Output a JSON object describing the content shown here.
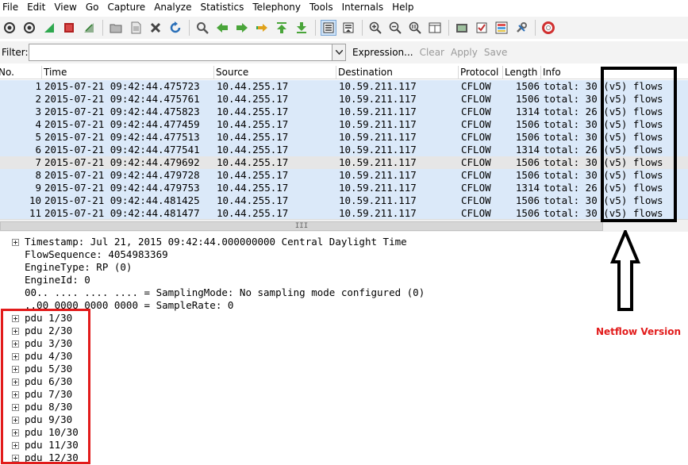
{
  "menu": [
    "File",
    "Edit",
    "View",
    "Go",
    "Capture",
    "Analyze",
    "Statistics",
    "Telephony",
    "Tools",
    "Internals",
    "Help"
  ],
  "toolbar": {
    "icons": [
      "interface-list-icon",
      "capture-options-icon",
      "start-capture-icon",
      "stop-capture-icon",
      "restart-capture-icon",
      "open-file-icon",
      "save-file-icon",
      "close-file-icon",
      "reload-icon",
      "find-icon",
      "go-back-icon",
      "go-forward-icon",
      "go-to-packet-icon",
      "go-first-icon",
      "go-last-icon",
      "colorize-icon",
      "auto-scroll-icon",
      "zoom-in-icon",
      "zoom-out-icon",
      "normal-size-icon",
      "resize-columns-icon",
      "capture-filters-icon",
      "display-filters-icon",
      "coloring-rules-icon",
      "preferences-icon",
      "help-icon"
    ]
  },
  "filter": {
    "label": "Filter:",
    "value": "",
    "expression_label": "Expression...",
    "clear_label": "Clear",
    "apply_label": "Apply",
    "save_label": "Save"
  },
  "packet_list": {
    "columns": [
      "No.",
      "Time",
      "Source",
      "Destination",
      "Protocol",
      "Length",
      "Info"
    ],
    "rows": [
      {
        "no": "1",
        "time": "2015-07-21 09:42:44.475723",
        "src": "10.44.255.17",
        "dst": "10.59.211.117",
        "proto": "CFLOW",
        "len": "1506",
        "info": "total: 30 (v5) flows"
      },
      {
        "no": "2",
        "time": "2015-07-21 09:42:44.475761",
        "src": "10.44.255.17",
        "dst": "10.59.211.117",
        "proto": "CFLOW",
        "len": "1506",
        "info": "total: 30 (v5) flows"
      },
      {
        "no": "3",
        "time": "2015-07-21 09:42:44.475823",
        "src": "10.44.255.17",
        "dst": "10.59.211.117",
        "proto": "CFLOW",
        "len": "1314",
        "info": "total: 26 (v5) flows"
      },
      {
        "no": "4",
        "time": "2015-07-21 09:42:44.477459",
        "src": "10.44.255.17",
        "dst": "10.59.211.117",
        "proto": "CFLOW",
        "len": "1506",
        "info": "total: 30 (v5) flows"
      },
      {
        "no": "5",
        "time": "2015-07-21 09:42:44.477513",
        "src": "10.44.255.17",
        "dst": "10.59.211.117",
        "proto": "CFLOW",
        "len": "1506",
        "info": "total: 30 (v5) flows"
      },
      {
        "no": "6",
        "time": "2015-07-21 09:42:44.477541",
        "src": "10.44.255.17",
        "dst": "10.59.211.117",
        "proto": "CFLOW",
        "len": "1314",
        "info": "total: 26 (v5) flows"
      },
      {
        "no": "7",
        "time": "2015-07-21 09:42:44.479692",
        "src": "10.44.255.17",
        "dst": "10.59.211.117",
        "proto": "CFLOW",
        "len": "1506",
        "info": "total: 30 (v5) flows"
      },
      {
        "no": "8",
        "time": "2015-07-21 09:42:44.479728",
        "src": "10.44.255.17",
        "dst": "10.59.211.117",
        "proto": "CFLOW",
        "len": "1506",
        "info": "total: 30 (v5) flows"
      },
      {
        "no": "9",
        "time": "2015-07-21 09:42:44.479753",
        "src": "10.44.255.17",
        "dst": "10.59.211.117",
        "proto": "CFLOW",
        "len": "1314",
        "info": "total: 26 (v5) flows"
      },
      {
        "no": "10",
        "time": "2015-07-21 09:42:44.481425",
        "src": "10.44.255.17",
        "dst": "10.59.211.117",
        "proto": "CFLOW",
        "len": "1506",
        "info": "total: 30 (v5) flows"
      },
      {
        "no": "11",
        "time": "2015-07-21 09:42:44.481477",
        "src": "10.44.255.17",
        "dst": "10.59.211.117",
        "proto": "CFLOW",
        "len": "1506",
        "info": "total: 30 (v5) flows"
      }
    ],
    "scroll_grip": "III"
  },
  "detail": {
    "lines": [
      {
        "text": "Timestamp: Jul 21, 2015 09:42:44.000000000 Central Daylight Time",
        "expandable": true
      },
      {
        "text": "FlowSequence: 4054983369",
        "expandable": false
      },
      {
        "text": "EngineType: RP (0)",
        "expandable": false
      },
      {
        "text": "EngineId: 0",
        "expandable": false
      },
      {
        "text": "00.. .... .... .... = SamplingMode: No sampling mode configured (0)",
        "expandable": false
      },
      {
        "text": "..00 0000 0000 0000 = SampleRate: 0",
        "expandable": false
      },
      {
        "text": "pdu 1/30",
        "expandable": true
      },
      {
        "text": "pdu 2/30",
        "expandable": true
      },
      {
        "text": "pdu 3/30",
        "expandable": true
      },
      {
        "text": "pdu 4/30",
        "expandable": true
      },
      {
        "text": "pdu 5/30",
        "expandable": true
      },
      {
        "text": "pdu 6/30",
        "expandable": true
      },
      {
        "text": "pdu 7/30",
        "expandable": true
      },
      {
        "text": "pdu 8/30",
        "expandable": true
      },
      {
        "text": "pdu 9/30",
        "expandable": true
      },
      {
        "text": "pdu 10/30",
        "expandable": true
      },
      {
        "text": "pdu 11/30",
        "expandable": true
      },
      {
        "text": "pdu 12/30",
        "expandable": true
      }
    ]
  },
  "annotation": {
    "label": "Netflow Version",
    "color": "#e21b1b"
  },
  "colors": {
    "row_selected": "#dbe9f9",
    "row_alt": "#e6e6e6"
  }
}
